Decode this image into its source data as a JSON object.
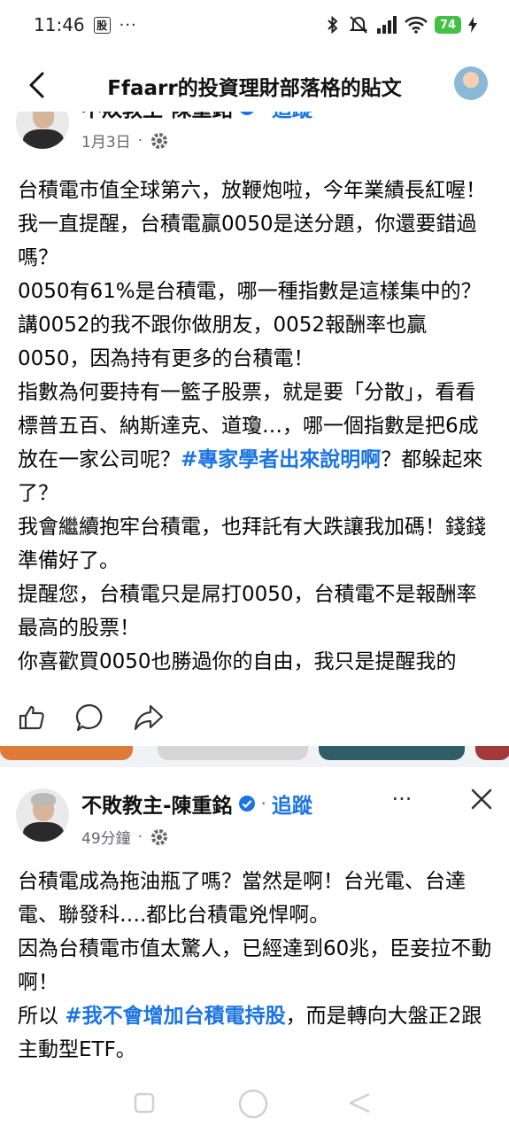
{
  "status_bar": {
    "time": "11:46",
    "notification_badge": "股",
    "more_notifications": "···",
    "battery": "74"
  },
  "header": {
    "title": "Ffaarr的投資理財部落格的貼文"
  },
  "post1": {
    "author": "不敗教主-陳重銘",
    "follow_label": "追蹤",
    "date": "1月3日",
    "text_before_hashtag": "台積電市值全球第六，放鞭炮啦，今年業績長紅喔！\n我一直提醒，台積電贏0050是送分題，你還要錯過嗎？\n0050有61%是台積電，哪一種指數是這樣集中的？講0052的我不跟你做朋友，0052報酬率也贏0050，因為持有更多的台積電！\n指數為何要持有一籃子股票，就是要「分散」，看看標普五百、納斯達克、道瓊…，哪一個指數是把6成放在一家公司呢？",
    "hashtag": "#專家學者出來說明啊",
    "text_after_hashtag": "？都躲起來了？\n我會繼續抱牢台積電，也拜託有大跌讓我加碼！錢錢準備好了。\n提醒您，台積電只是屌打0050，台積電不是報酬率最高的股票！\n你喜歡買0050也勝過你的自由，我只是提醒我的"
  },
  "post2": {
    "author": "不敗教主-陳重銘",
    "follow_label": "追蹤",
    "time_ago": "49分鐘",
    "more_label": "···",
    "text_before_hashtag": "台積電成為拖油瓶了嗎？當然是啊！台光電、台達電、聯發科….都比台積電兇悍啊。\n因為台積電市值太驚人，已經達到60兆，臣妾拉不動啊！\n所以 ",
    "hashtag": "#我不會增加台積電持股",
    "text_after_hashtag": "，而是轉向大盤正2跟主動型ETF。"
  },
  "colors": {
    "accent": "#1b74e4",
    "battery": "#44c144",
    "separator": "#f0f2f5"
  },
  "icons": [
    "back-arrow-icon",
    "verified-badge-icon",
    "globe-settings-icon",
    "like-icon",
    "comment-icon",
    "share-icon",
    "more-options-icon",
    "close-icon",
    "bluetooth-icon",
    "mute-icon",
    "signal-icon",
    "wifi-icon",
    "charging-icon",
    "recents-nav-icon",
    "home-nav-icon",
    "back-nav-icon"
  ]
}
